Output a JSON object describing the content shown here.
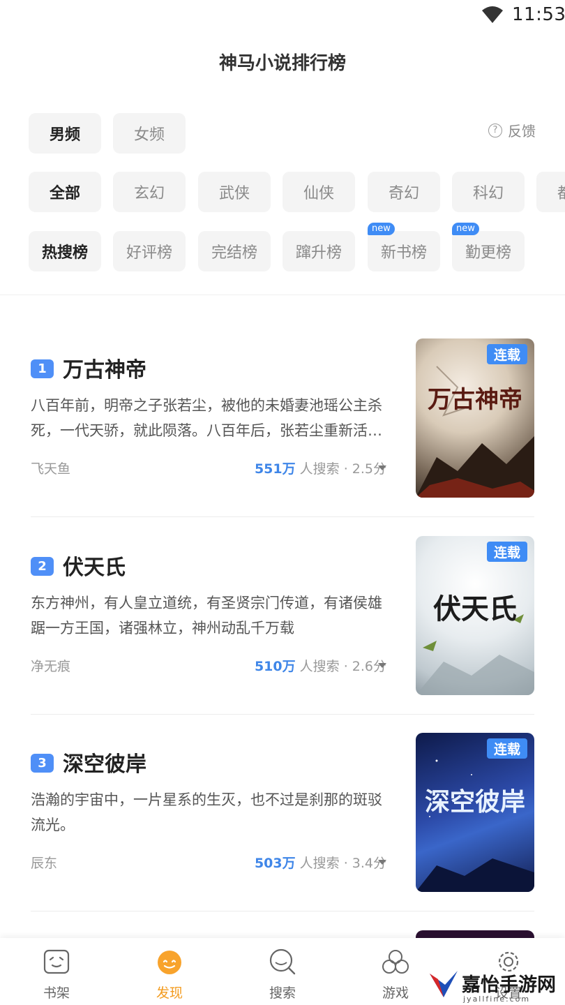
{
  "status_bar": {
    "time": "11:53"
  },
  "page_title": "神马小说排行榜",
  "gender_tabs": [
    {
      "label": "男频",
      "active": true
    },
    {
      "label": "女频",
      "active": false
    }
  ],
  "feedback_label": "反馈",
  "genre_chips": [
    {
      "label": "全部",
      "active": true
    },
    {
      "label": "玄幻",
      "active": false
    },
    {
      "label": "武侠",
      "active": false
    },
    {
      "label": "仙侠",
      "active": false
    },
    {
      "label": "奇幻",
      "active": false
    },
    {
      "label": "科幻",
      "active": false
    },
    {
      "label": "都",
      "active": false
    }
  ],
  "list_chips": [
    {
      "label": "热搜榜",
      "active": true,
      "badge": ""
    },
    {
      "label": "好评榜",
      "active": false,
      "badge": ""
    },
    {
      "label": "完结榜",
      "active": false,
      "badge": ""
    },
    {
      "label": "蹿升榜",
      "active": false,
      "badge": ""
    },
    {
      "label": "新书榜",
      "active": false,
      "badge": "new"
    },
    {
      "label": "勤更榜",
      "active": false,
      "badge": "new"
    }
  ],
  "books": [
    {
      "rank": "1",
      "title": "万古神帝",
      "description": "八百年前，明帝之子张若尘，被他的未婚妻池瑶公主杀死，一代天骄，就此陨落。八百年后，张若尘重新活了过来",
      "author": "飞天鱼",
      "search_count": "551万",
      "search_suffix": "人搜索 · 2.5分",
      "status_tag": "连载",
      "cover_title": "万古神帝"
    },
    {
      "rank": "2",
      "title": "伏天氏",
      "description": "东方神州，有人皇立道统，有圣贤宗门传道，有诸侯雄踞一方王国，诸强林立，神州动乱千万载",
      "author": "净无痕",
      "search_count": "510万",
      "search_suffix": "人搜索 · 2.6分",
      "status_tag": "连载",
      "cover_title": "伏天氏"
    },
    {
      "rank": "3",
      "title": "深空彼岸",
      "description": "浩瀚的宇宙中，一片星系的生灭，也不过是刹那的斑驳流光。",
      "author": "辰东",
      "search_count": "503万",
      "search_suffix": "人搜索 · 3.4分",
      "status_tag": "连载",
      "cover_title": "深空彼岸"
    }
  ],
  "bottom_nav": [
    {
      "label": "书架",
      "icon": "bookshelf-icon",
      "active": false
    },
    {
      "label": "发现",
      "icon": "discover-icon",
      "active": true
    },
    {
      "label": "搜索",
      "icon": "search-icon",
      "active": false
    },
    {
      "label": "游戏",
      "icon": "game-icon",
      "active": false
    },
    {
      "label": "设置",
      "icon": "settings-icon",
      "active": false
    }
  ],
  "watermark": {
    "text": "嘉怡手游网",
    "url": "jyallfine.com"
  },
  "colors": {
    "accent": "#3f8cf5",
    "active_nav": "#f39b1e",
    "stat_number": "#3f86e8"
  }
}
